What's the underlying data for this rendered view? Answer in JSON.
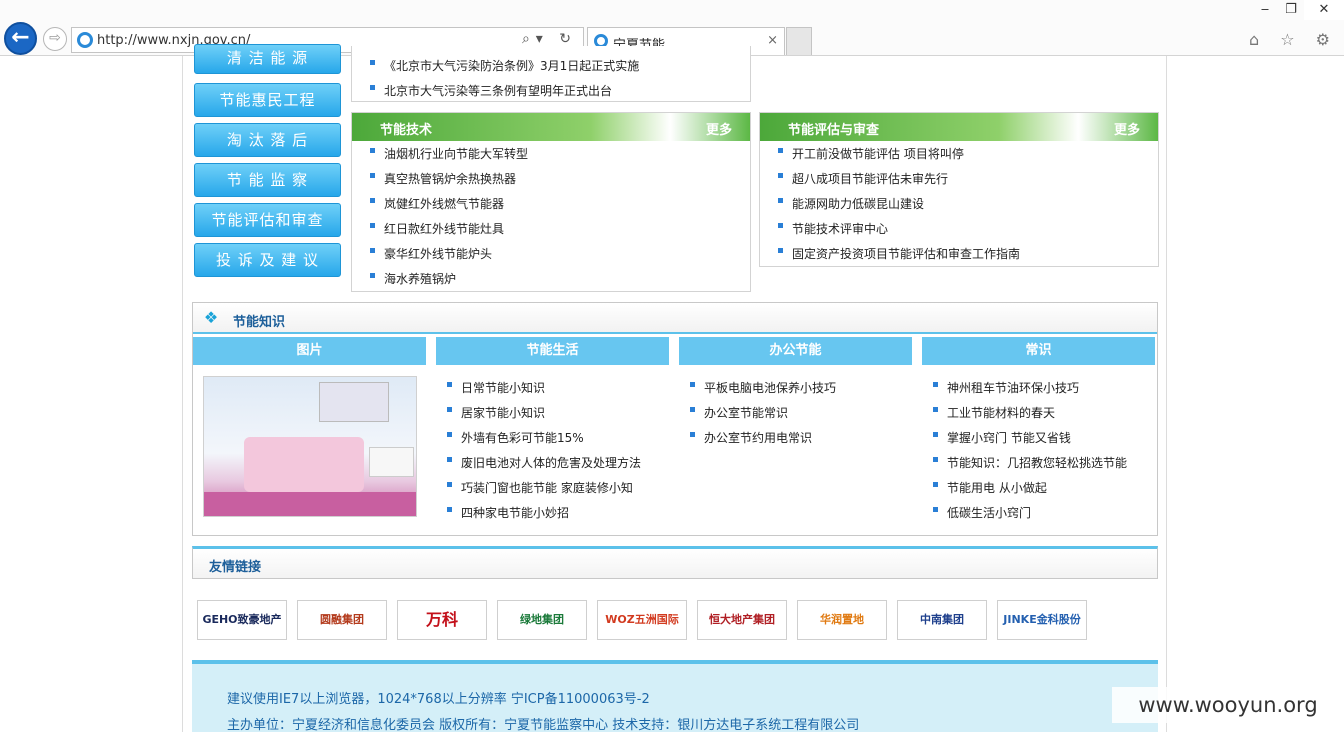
{
  "browser": {
    "url": "http://www.nxjn.gov.cn/",
    "tab_title": "宁夏节能",
    "tab_close": "×",
    "address_tools": "⌕▾ ↻",
    "win_min": "‒",
    "win_max": "❐",
    "win_close": "✕",
    "right_tools": "⌂ ☆ ⚙"
  },
  "sidebar": {
    "items": [
      {
        "label": "清 洁 能 源"
      },
      {
        "label": "节能惠民工程"
      },
      {
        "label": "淘 汰 落 后"
      },
      {
        "label": "节 能 监 察"
      },
      {
        "label": "节能评估和审查"
      },
      {
        "label": "投 诉 及 建 议"
      }
    ]
  },
  "top_list": {
    "items": [
      "《北京市大气污染防治条例》3月1日起正式实施",
      "北京市大气污染等三条例有望明年正式出台"
    ]
  },
  "tech": {
    "title": "节能技术",
    "more": "更多",
    "items": [
      "油烟机行业向节能大军转型",
      "真空热管锅炉余热换热器",
      "岚健红外线燃气节能器",
      "红日款红外线节能灶具",
      "豪华红外线节能炉头",
      "海水养殖锅炉"
    ]
  },
  "review": {
    "title": "节能评估与审查",
    "more": "更多",
    "items": [
      "开工前没做节能评估 项目将叫停",
      "超八成项目节能评估未审先行",
      "能源网助力低碳昆山建设",
      "节能技术评审中心",
      "固定资产投资项目节能评估和审查工作指南"
    ]
  },
  "knowledge": {
    "title": "节能知识",
    "columns": [
      {
        "title": "图片"
      },
      {
        "title": "节能生活",
        "items": [
          "日常节能小知识",
          "居家节能小知识",
          "外墙有色彩可节能15%",
          "废旧电池对人体的危害及处理方法",
          "巧装门窗也能节能 家庭装修小知",
          "四种家电节能小妙招"
        ]
      },
      {
        "title": "办公节能",
        "items": [
          "平板电脑电池保养小技巧",
          "办公室节能常识",
          "办公室节约用电常识"
        ]
      },
      {
        "title": "常识",
        "items": [
          "神州租车节油环保小技巧",
          "工业节能材料的春天",
          "掌握小窍门 节能又省钱",
          "节能知识：几招教您轻松挑选节能",
          "节能用电 从小做起",
          "低碳生活小窍门"
        ]
      }
    ]
  },
  "links": {
    "title": "友情链接",
    "logos": [
      {
        "text": "GEHO致豪地产",
        "color": "#1a2a5c"
      },
      {
        "text": "圆融集团",
        "color": "#b33a1c"
      },
      {
        "text": "万科",
        "color": "#c3101a"
      },
      {
        "text": "绿地集团",
        "color": "#1b7a3a"
      },
      {
        "text": "WOZ五洲国际",
        "color": "#d23a1f"
      },
      {
        "text": "恒大地产集团",
        "color": "#b01f24"
      },
      {
        "text": "华润置地",
        "color": "#e07a12"
      },
      {
        "text": "中南集团",
        "color": "#1e3f8c"
      },
      {
        "text": "JINKE金科股份",
        "color": "#2460b0"
      }
    ]
  },
  "footer": {
    "line1": "建议使用IE7以上浏览器，1024*768以上分辨率    宁ICP备11000063号-2",
    "line2": "主办单位：宁夏经济和信息化委员会    版权所有：宁夏节能监察中心    技术支持：银川方达电子系统工程有限公司"
  },
  "watermark": "www.wooyun.org"
}
